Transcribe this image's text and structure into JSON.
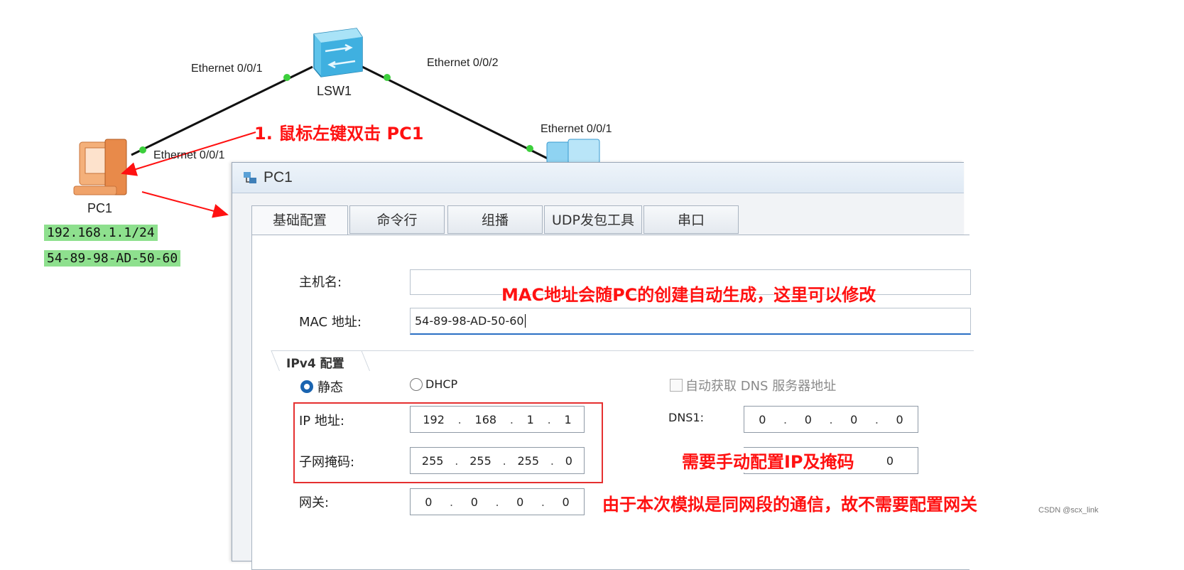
{
  "topology": {
    "switch_label": "LSW1",
    "pc_label": "PC1",
    "ports": {
      "lsw_left": "Ethernet 0/0/1",
      "lsw_right": "Ethernet 0/0/2",
      "pc1_port": "Ethernet 0/0/1",
      "pc2_port": "Ethernet 0/0/1"
    },
    "pc1_ip_tag": "192.168.1.1/24",
    "pc1_mac_tag": "54-89-98-AD-50-60"
  },
  "annotations": {
    "step1": "1. 鼠标左键双击 PC1",
    "mac_note": "MAC地址会随PC的创建自动生成，这里可以修改",
    "ip_note": "需要手动配置IP及掩码",
    "gateway_note": "由于本次模拟是同网段的通信，故不需要配置网关",
    "color": "#ff1111"
  },
  "dialog": {
    "title": "PC1",
    "tabs": [
      {
        "label": "基础配置"
      },
      {
        "label": "命令行"
      },
      {
        "label": "组播"
      },
      {
        "label": "UDP发包工具"
      },
      {
        "label": "串口"
      }
    ],
    "hostname_label": "主机名:",
    "hostname_value": "",
    "mac_label": "MAC 地址:",
    "mac_value": "54-89-98-AD-50-60",
    "ipv4_group": "IPv4 配置",
    "static_label": "静态",
    "dhcp_label": "DHCP",
    "auto_dns_label": "自动获取 DNS 服务器地址",
    "ip_label": "IP 地址:",
    "ip": [
      "192",
      "168",
      "1",
      "1"
    ],
    "mask_label": "子网掩码:",
    "mask": [
      "255",
      "255",
      "255",
      "0"
    ],
    "gateway_label": "网关:",
    "gateway": [
      "0",
      "0",
      "0",
      "0"
    ],
    "dns1_label": "DNS1:",
    "dns1": [
      "0",
      "0",
      "0",
      "0"
    ],
    "dns2_last": "0"
  },
  "watermark": "CSDN @scx_link"
}
